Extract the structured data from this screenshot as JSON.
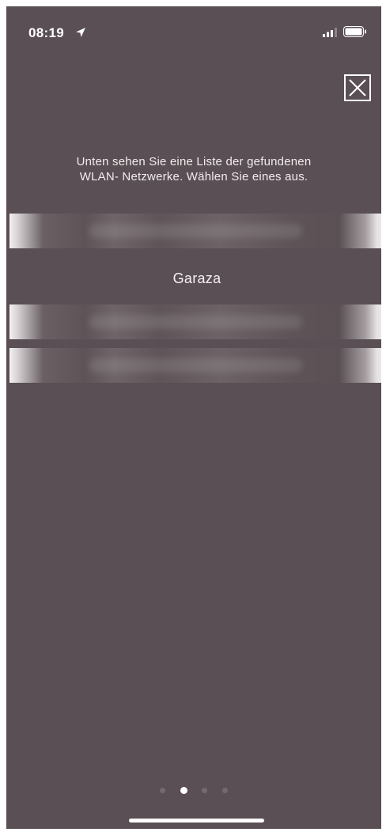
{
  "status_bar": {
    "time": "08:19",
    "location_icon": "location-arrow-icon",
    "signal_icon": "cellular-signal-icon",
    "battery_icon": "battery-icon"
  },
  "close_icon": "close-icon",
  "instruction": {
    "line1": "Unten sehen Sie eine Liste der gefundenen",
    "line2": "WLAN- Netzwerke. Wählen Sie eines aus."
  },
  "networks": [
    {
      "name": "",
      "blurred": true
    },
    {
      "name": "Garaza",
      "blurred": false
    },
    {
      "name": "",
      "blurred": true
    },
    {
      "name": "",
      "blurred": true
    }
  ],
  "pager": {
    "count": 4,
    "active_index": 1
  },
  "colors": {
    "background": "#5a4f54",
    "text": "#ffffff"
  }
}
